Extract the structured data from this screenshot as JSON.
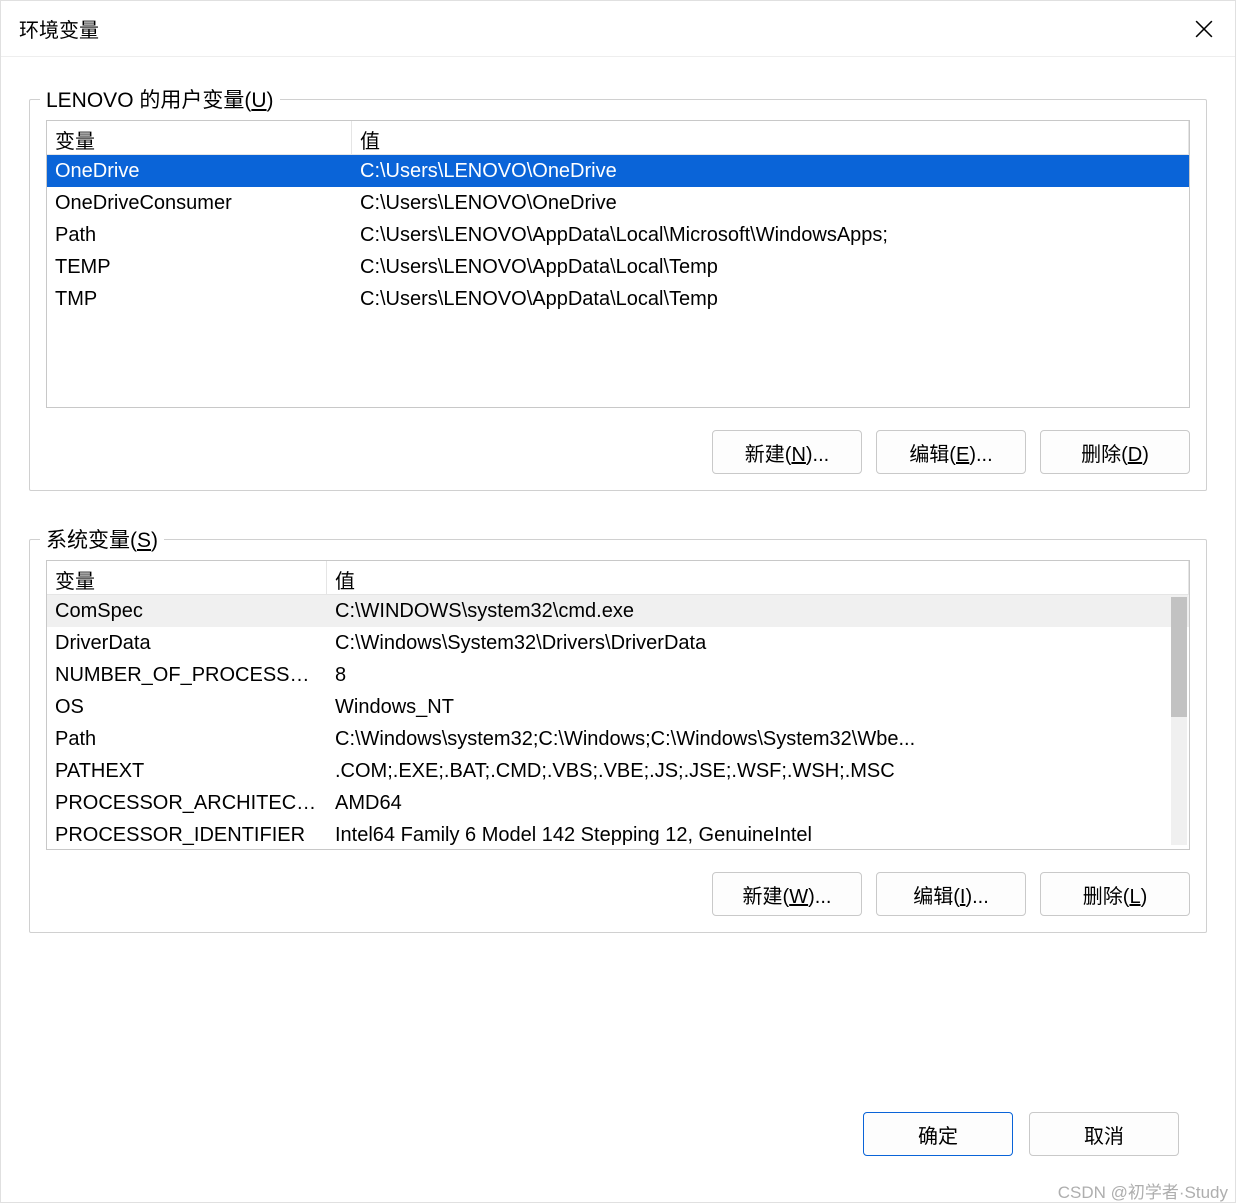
{
  "window": {
    "title": "环境变量"
  },
  "user_section": {
    "legend_prefix": "LENOVO 的用户变量(",
    "legend_key": "U",
    "legend_suffix": ")",
    "columns": {
      "var": "变量",
      "val": "值"
    },
    "rows": [
      {
        "name": "OneDrive",
        "value": "C:\\Users\\LENOVO\\OneDrive",
        "selected": true
      },
      {
        "name": "OneDriveConsumer",
        "value": "C:\\Users\\LENOVO\\OneDrive"
      },
      {
        "name": "Path",
        "value": "C:\\Users\\LENOVO\\AppData\\Local\\Microsoft\\WindowsApps;"
      },
      {
        "name": "TEMP",
        "value": "C:\\Users\\LENOVO\\AppData\\Local\\Temp"
      },
      {
        "name": "TMP",
        "value": "C:\\Users\\LENOVO\\AppData\\Local\\Temp"
      }
    ],
    "buttons": {
      "new": {
        "label": "新建(",
        "key": "N",
        "suffix": ")..."
      },
      "edit": {
        "label": "编辑(",
        "key": "E",
        "suffix": ")..."
      },
      "delete": {
        "label": "删除(",
        "key": "D",
        "suffix": ")"
      }
    }
  },
  "system_section": {
    "legend_prefix": "系统变量(",
    "legend_key": "S",
    "legend_suffix": ")",
    "columns": {
      "var": "变量",
      "val": "值"
    },
    "rows": [
      {
        "name": "ComSpec",
        "value": "C:\\WINDOWS\\system32\\cmd.exe",
        "selected": true
      },
      {
        "name": "DriverData",
        "value": "C:\\Windows\\System32\\Drivers\\DriverData"
      },
      {
        "name": "NUMBER_OF_PROCESSORS",
        "value": "8"
      },
      {
        "name": "OS",
        "value": "Windows_NT"
      },
      {
        "name": "Path",
        "value": "C:\\Windows\\system32;C:\\Windows;C:\\Windows\\System32\\Wbe..."
      },
      {
        "name": "PATHEXT",
        "value": ".COM;.EXE;.BAT;.CMD;.VBS;.VBE;.JS;.JSE;.WSF;.WSH;.MSC"
      },
      {
        "name": "PROCESSOR_ARCHITECTU...",
        "value": "AMD64"
      },
      {
        "name": "PROCESSOR_IDENTIFIER",
        "value": "Intel64 Family 6 Model 142 Stepping 12, GenuineIntel"
      }
    ],
    "buttons": {
      "new": {
        "label": "新建(",
        "key": "W",
        "suffix": ")..."
      },
      "edit": {
        "label": "编辑(",
        "key": "I",
        "suffix": ")..."
      },
      "delete": {
        "label": "删除(",
        "key": "L",
        "suffix": ")"
      }
    }
  },
  "footer": {
    "ok": "确定",
    "cancel": "取消"
  },
  "watermark": "CSDN @初学者·Study"
}
